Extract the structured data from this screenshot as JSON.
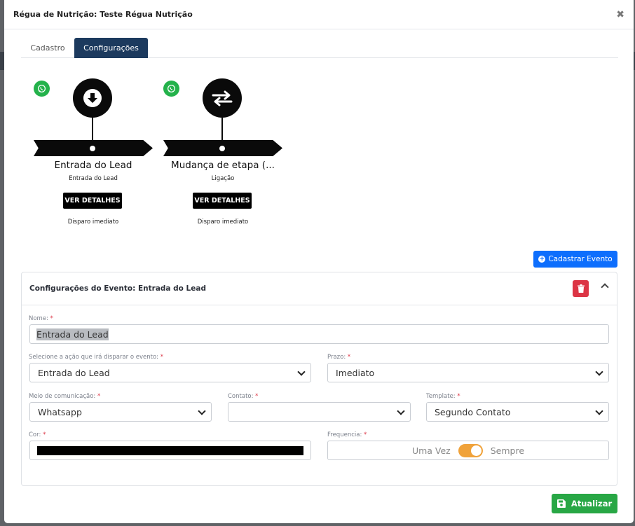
{
  "modal": {
    "title": "Régua de Nutrição: Teste Régua Nutrição",
    "close_symbol": "✖"
  },
  "tabs": [
    {
      "label": "Cadastro",
      "active": false
    },
    {
      "label": "Configurações",
      "active": true
    }
  ],
  "timeline": [
    {
      "icon": "arrow-down-circle-icon",
      "channel_icon": "whatsapp-icon",
      "title": "Entrada do Lead",
      "subtitle": "Entrada do Lead",
      "button": "VER DETALHES",
      "footer": "Disparo imediato"
    },
    {
      "icon": "exchange-arrows-icon",
      "channel_icon": "whatsapp-icon",
      "title": "Mudança de etapa (...",
      "subtitle": "Ligação",
      "button": "VER DETALHES",
      "footer": "Disparo imediato"
    }
  ],
  "add_event_button": "Cadastrar Evento",
  "event_config": {
    "title": "Configurações do Evento: Entrada do Lead",
    "fields": {
      "nome": {
        "label": "Nome:",
        "value": "Entrada do Lead"
      },
      "acao": {
        "label": "Selecione a ação que irá disparar o evento:",
        "value": "Entrada do Lead"
      },
      "prazo": {
        "label": "Prazo:",
        "value": "Imediato"
      },
      "meio": {
        "label": "Meio de comunicação:",
        "value": "Whatsapp"
      },
      "contato": {
        "label": "Contato:",
        "value": ""
      },
      "template": {
        "label": "Template:",
        "value": "Segundo Contato"
      },
      "cor": {
        "label": "Cor:",
        "value": "#000000"
      },
      "frequencia": {
        "label": "Frequencia:",
        "option_left": "Uma Vez",
        "option_right": "Sempre",
        "selected": "Sempre"
      }
    },
    "required_mark": "*"
  },
  "update_button": "Atualizar",
  "colors": {
    "tab_active": "#1c3a5e",
    "primary": "#0d6efd",
    "danger": "#dc3545",
    "success": "#28a745",
    "whatsapp": "#24b24b",
    "toggle": "#f0a23a"
  }
}
